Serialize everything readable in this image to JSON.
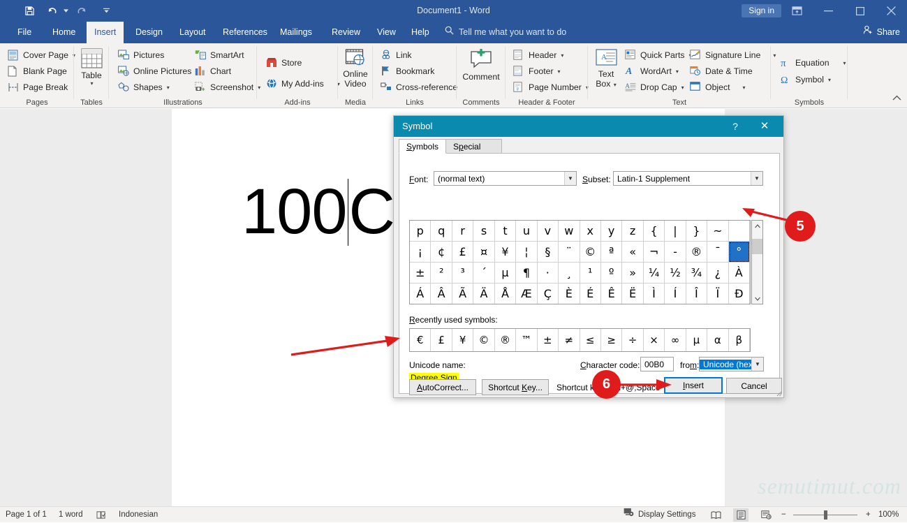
{
  "titlebar": {
    "document_title": "Document1  -  Word",
    "signin_label": "Sign in",
    "quick_access": [
      {
        "name": "save-icon",
        "label": "Save"
      },
      {
        "name": "undo-icon",
        "label": "Undo"
      },
      {
        "name": "redo-icon",
        "label": "Redo"
      },
      {
        "name": "customize-qat-icon",
        "label": "Customize Quick Access Toolbar"
      }
    ],
    "window_buttons": [
      {
        "name": "ribbon-display-options-icon",
        "glyph": "⊡"
      },
      {
        "name": "minimize-icon",
        "glyph": "─"
      },
      {
        "name": "maximize-icon",
        "glyph": "☐"
      },
      {
        "name": "close-icon",
        "glyph": "✕"
      }
    ]
  },
  "tabs": [
    {
      "label": "File",
      "active": false
    },
    {
      "label": "Home",
      "active": false
    },
    {
      "label": "Insert",
      "active": true
    },
    {
      "label": "Design",
      "active": false
    },
    {
      "label": "Layout",
      "active": false
    },
    {
      "label": "References",
      "active": false
    },
    {
      "label": "Mailings",
      "active": false
    },
    {
      "label": "Review",
      "active": false
    },
    {
      "label": "View",
      "active": false
    },
    {
      "label": "Help",
      "active": false
    }
  ],
  "tellme": {
    "placeholder": "Tell me what you want to do"
  },
  "share": {
    "label": "Share"
  },
  "ribbon": {
    "groups": [
      {
        "name": "pages",
        "label": "Pages",
        "items": [
          {
            "label": "Cover Page",
            "icon": "cover-page-icon",
            "dropdown": true
          },
          {
            "label": "Blank Page",
            "icon": "blank-page-icon",
            "dropdown": false
          },
          {
            "label": "Page Break",
            "icon": "page-break-icon",
            "dropdown": false
          }
        ]
      },
      {
        "name": "tables",
        "label": "Tables",
        "big": [
          {
            "label": "Table",
            "icon": "table-icon",
            "dropdown": true
          }
        ]
      },
      {
        "name": "illustrations",
        "label": "Illustrations",
        "items": [
          {
            "label": "Pictures",
            "icon": "pictures-icon",
            "dropdown": false
          },
          {
            "label": "Online Pictures",
            "icon": "online-pictures-icon",
            "dropdown": false
          },
          {
            "label": "Shapes",
            "icon": "shapes-icon",
            "dropdown": true
          },
          {
            "label": "SmartArt",
            "icon": "smartart-icon",
            "dropdown": false
          },
          {
            "label": "Chart",
            "icon": "chart-icon",
            "dropdown": false
          },
          {
            "label": "Screenshot",
            "icon": "screenshot-icon",
            "dropdown": true
          }
        ]
      },
      {
        "name": "add-ins",
        "label": "Add-ins",
        "items": [
          {
            "label": "Store",
            "icon": "store-icon",
            "dropdown": false
          },
          {
            "label": "My Add-ins",
            "icon": "my-addins-icon",
            "dropdown": true
          }
        ]
      },
      {
        "name": "media",
        "label": "Media",
        "big": [
          {
            "label": "Online\nVideo",
            "icon": "online-video-icon",
            "dropdown": false
          }
        ]
      },
      {
        "name": "links",
        "label": "Links",
        "items": [
          {
            "label": "Link",
            "icon": "link-icon",
            "dropdown": false
          },
          {
            "label": "Bookmark",
            "icon": "bookmark-icon",
            "dropdown": false
          },
          {
            "label": "Cross-reference",
            "icon": "cross-reference-icon",
            "dropdown": false
          }
        ]
      },
      {
        "name": "comments",
        "label": "Comments",
        "big": [
          {
            "label": "Comment",
            "icon": "comment-icon",
            "dropdown": false
          }
        ]
      },
      {
        "name": "header-footer",
        "label": "Header & Footer",
        "items": [
          {
            "label": "Header",
            "icon": "header-icon",
            "dropdown": true
          },
          {
            "label": "Footer",
            "icon": "footer-icon",
            "dropdown": true
          },
          {
            "label": "Page Number",
            "icon": "page-number-icon",
            "dropdown": true
          }
        ]
      },
      {
        "name": "text",
        "label": "Text",
        "big": [
          {
            "label": "Text\nBox",
            "icon": "text-box-icon",
            "dropdown": true
          }
        ],
        "items": [
          {
            "label": "Quick Parts",
            "icon": "quick-parts-icon",
            "dropdown": true
          },
          {
            "label": "WordArt",
            "icon": "wordart-icon",
            "dropdown": true
          },
          {
            "label": "Drop Cap",
            "icon": "drop-cap-icon",
            "dropdown": true
          },
          {
            "label": "Signature Line",
            "icon": "signature-line-icon",
            "dropdown": true
          },
          {
            "label": "Date & Time",
            "icon": "date-time-icon",
            "dropdown": false
          },
          {
            "label": "Object",
            "icon": "object-icon",
            "dropdown": true
          }
        ]
      },
      {
        "name": "symbols",
        "label": "Symbols",
        "items": [
          {
            "label": "Equation",
            "icon": "equation-icon",
            "dropdown": true
          },
          {
            "label": "Symbol",
            "icon": "symbol-icon",
            "dropdown": true
          }
        ]
      }
    ],
    "collapse_label": "ⱏ"
  },
  "document": {
    "text_before_caret": "100",
    "text_after_caret": "C",
    "watermark": "semutimut.com"
  },
  "dialog": {
    "title": "Symbol",
    "help_glyph": "?",
    "close_glyph": "✕",
    "tabs": [
      {
        "label": "Symbols",
        "accesskey": "S",
        "active": true
      },
      {
        "label": "Special Characters",
        "accesskey": "p",
        "active": false
      }
    ],
    "font_label": "Font:",
    "font_value": "(normal text)",
    "subset_label": "Subset:",
    "subset_value": "Latin-1 Supplement",
    "grid_rows": [
      [
        "p",
        "q",
        "r",
        "s",
        "t",
        "u",
        "v",
        "w",
        "x",
        "y",
        "z",
        "{",
        "|",
        "}",
        "~",
        ""
      ],
      [
        "¡",
        "¢",
        "£",
        "¤",
        "¥",
        "¦",
        "§",
        "¨",
        "©",
        "ª",
        "«",
        "¬",
        "-",
        "®",
        "¯",
        "°"
      ],
      [
        "±",
        "²",
        "³",
        "´",
        "µ",
        "¶",
        "·",
        "¸",
        "¹",
        "º",
        "»",
        "¼",
        "½",
        "¾",
        "¿",
        "À"
      ],
      [
        "Á",
        "Â",
        "Ã",
        "Ä",
        "Å",
        "Æ",
        "Ç",
        "È",
        "É",
        "Ê",
        "Ë",
        "Ì",
        "Í",
        "Î",
        "Ï",
        "Ð"
      ]
    ],
    "selected_cell": {
      "row": 1,
      "col": 15,
      "char": "°"
    },
    "recent_label": "Recently used symbols:",
    "recent_symbols": [
      "€",
      "£",
      "¥",
      "©",
      "®",
      "™",
      "±",
      "≠",
      "≤",
      "≥",
      "÷",
      "×",
      "∞",
      "µ",
      "α",
      "β"
    ],
    "unicode_name_label": "Unicode name:",
    "unicode_name_value": "Degree Sign",
    "charcode_label": "Character code:",
    "charcode_value": "00B0",
    "from_label": "from:",
    "from_value": "Unicode (hex)",
    "autocorrect_label": "AutoCorrect...",
    "shortcut_key_button": "Shortcut Key...",
    "shortcut_key_text": "Shortcut key: Ctrl+@,Space",
    "insert_label": "Insert",
    "cancel_label": "Cancel"
  },
  "annotations": [
    {
      "name": "step-badge-5",
      "number": "5"
    },
    {
      "name": "step-badge-6",
      "number": "6"
    }
  ],
  "statusbar": {
    "page_info": "Page 1 of 1",
    "word_count": "1 word",
    "proofing_icon": "proofing-errors-icon",
    "language": "Indonesian",
    "display_settings": "Display Settings",
    "zoom_level": "100%",
    "zoom_out": "−",
    "zoom_in": "+",
    "views": [
      {
        "name": "read-mode-icon",
        "selected": false
      },
      {
        "name": "print-layout-icon",
        "selected": true
      },
      {
        "name": "web-layout-icon",
        "selected": false
      }
    ]
  },
  "colors": {
    "word_blue": "#2b579a",
    "dialog_teal": "#0b8ab0",
    "accent_red": "#e01b1b",
    "selection_blue": "#1f72c8",
    "highlight_yellow": "#ffff00",
    "focus_blue": "#0078d7"
  }
}
